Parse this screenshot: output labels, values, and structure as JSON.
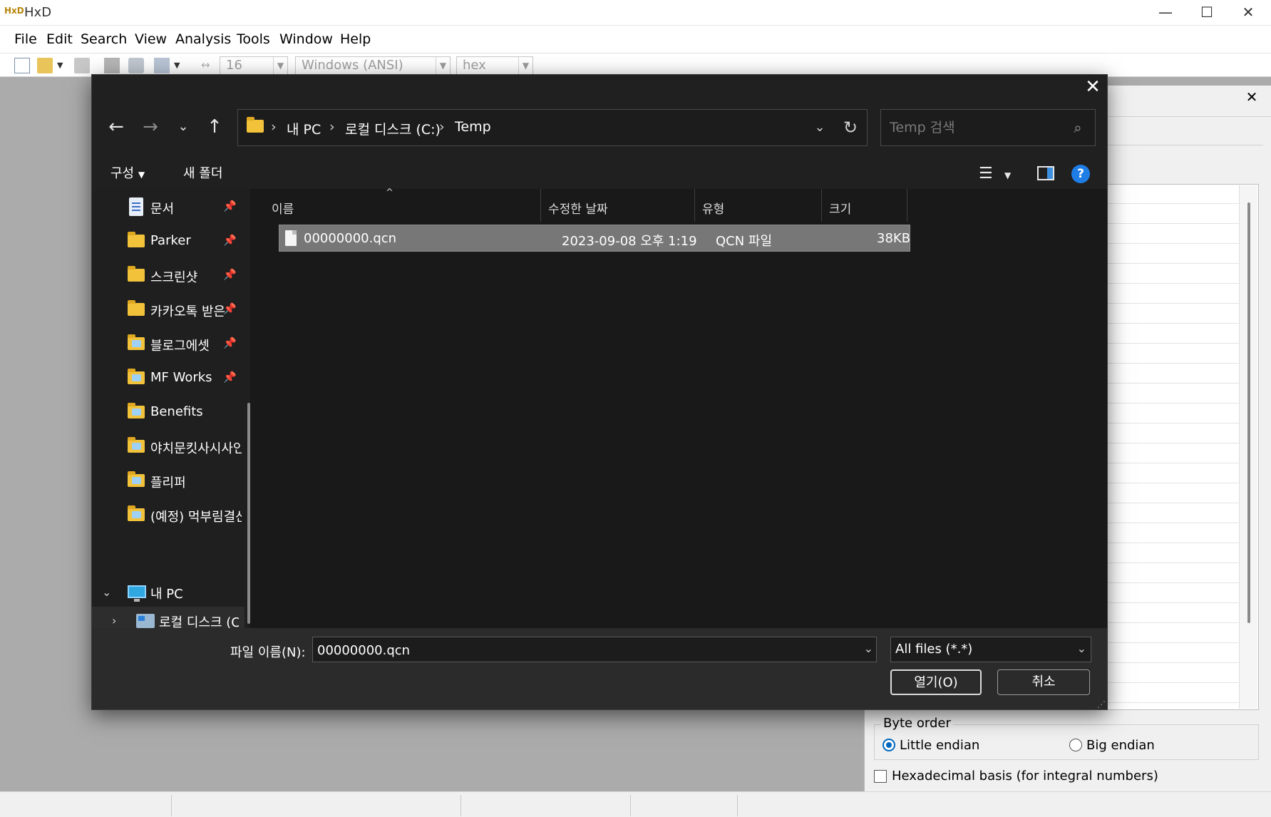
{
  "window": {
    "title": "HxD",
    "minimize_icon": "minimize-icon",
    "maximize_icon": "maximize-icon",
    "close_icon": "close-icon"
  },
  "menu": [
    "File",
    "Edit",
    "Search",
    "View",
    "Analysis",
    "Tools",
    "Window",
    "Help"
  ],
  "toolbar": {
    "bytes_per_row": "16",
    "charset": "Windows (ANSI)",
    "offset_base": "hex"
  },
  "inspector": {
    "byte_order_label": "Byte order",
    "little_endian": "Little endian",
    "big_endian": "Big endian",
    "selected_byte_order": "little",
    "hex_basis_label": "Hexadecimal basis (for integral numbers)",
    "hex_basis_checked": false
  },
  "dialog": {
    "breadcrumb": [
      "내 PC",
      "로컬 디스크 (C:)",
      "Temp"
    ],
    "search_placeholder": "Temp 검색",
    "organize_label": "구성",
    "new_folder_label": "새 폴더",
    "help_label": "?",
    "nav_items": [
      {
        "label": "문서",
        "icon": "document-icon",
        "pinned": true
      },
      {
        "label": "Parker",
        "icon": "folder-icon",
        "pinned": true
      },
      {
        "label": "스크린샷",
        "icon": "folder-icon",
        "pinned": true
      },
      {
        "label": "카카오톡 받은",
        "icon": "folder-icon",
        "pinned": true
      },
      {
        "label": "블로그에셋",
        "icon": "folder-image-icon",
        "pinned": true
      },
      {
        "label": "MF Works",
        "icon": "folder-image-icon",
        "pinned": true
      },
      {
        "label": "Benefits",
        "icon": "folder-image-icon",
        "pinned": false
      },
      {
        "label": "야치문킷사시사인",
        "icon": "folder-image-icon",
        "pinned": false
      },
      {
        "label": "플리퍼",
        "icon": "folder-image-icon",
        "pinned": false
      },
      {
        "label": "(예정) 먹부림결산",
        "icon": "folder-image-icon",
        "pinned": false
      }
    ],
    "this_pc_label": "내 PC",
    "local_disk_label": "로컬 디스크 (C:",
    "columns": [
      "이름",
      "수정한 날짜",
      "유형",
      "크기"
    ],
    "files": [
      {
        "name": "00000000.qcn",
        "modified": "2023-09-08 오후 1:19",
        "type": "QCN 파일",
        "size": "38KB"
      }
    ],
    "filename_label": "파일 이름(N):",
    "filename_value": "00000000.qcn",
    "filter_value": "All files (*.*)",
    "open_button": "열기(O)",
    "cancel_button": "취소"
  }
}
